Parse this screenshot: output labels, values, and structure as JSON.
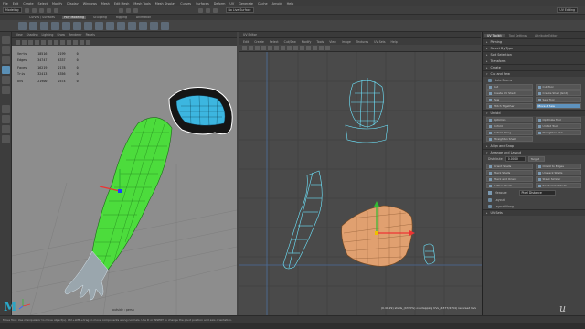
{
  "menu": [
    "File",
    "Edit",
    "Create",
    "Select",
    "Modify",
    "Display",
    "Windows",
    "Mesh",
    "Edit Mesh",
    "Mesh Tools",
    "Mesh Display",
    "Curves",
    "Surfaces",
    "Deform",
    "UV",
    "Generate",
    "Cache",
    "Arnold",
    "Help"
  ],
  "status": {
    "mode": "Modeling",
    "symmetry": "No Live Surface",
    "workspace": "UV Editing"
  },
  "shelf_tabs": [
    {
      "label": "Curves / Surfaces",
      "active": false
    },
    {
      "label": "Poly Modeling",
      "active": true
    },
    {
      "label": "Sculpting",
      "active": false
    },
    {
      "label": "Rigging",
      "active": false
    },
    {
      "label": "Animation",
      "active": false
    }
  ],
  "viewport": {
    "menus": [
      "View",
      "Shading",
      "Lighting",
      "Show",
      "Renderer",
      "Panels"
    ],
    "hud": [
      {
        "label": "Verts",
        "a": "18516",
        "b": "2199",
        "c": "0"
      },
      {
        "label": "Edges",
        "a": "34747",
        "b": "4337",
        "c": "0"
      },
      {
        "label": "Faces",
        "a": "16219",
        "b": "2178",
        "c": "0"
      },
      {
        "label": "Tris",
        "a": "32413",
        "b": "4356",
        "c": "0"
      },
      {
        "label": "UVs",
        "a": "21900",
        "b": "2574",
        "c": "0"
      }
    ],
    "camera": "outside : persp"
  },
  "uv_editor": {
    "title": "UV Editor",
    "menus": [
      "Edit",
      "Create",
      "Select",
      "Cut/Sew",
      "Modify",
      "Tools",
      "View",
      "Image",
      "Textures",
      "UV Sets",
      "Help"
    ],
    "stat": "(0.40.29) shells_(4370%) overlapping UVs_(4377/4354) reversed UVs"
  },
  "toolkit": {
    "tabs": [
      {
        "label": "UV Toolkit",
        "active": true
      },
      {
        "label": "Tool Settings",
        "active": false
      },
      {
        "label": "Attribute Editor",
        "active": false
      }
    ],
    "sections": {
      "pinning": "Pinning",
      "select_by_type": "Select By Type",
      "soft_selection": "Soft Selection",
      "transform": "Transform",
      "create": "Create",
      "cut_and_sew": "Cut and Sew",
      "unfold": "Unfold",
      "align_and_snap": "Align and Snap",
      "arrange_and_layout": "Arrange and Layout",
      "uv_sets": "UV Sets"
    },
    "auto_seams": "Auto Seams",
    "cut_sew": [
      "Cut",
      "Cut Tool",
      "Create UV Shell",
      "Create Shell (Grid)",
      "Sew",
      "Sew Tool",
      "Stitch Together",
      "Move & Sew"
    ],
    "unfold": [
      "Optimize",
      "Optimize Tool",
      "Unfold",
      "Unfold Tool",
      "Unfold Along",
      "Straighten UVs",
      "Straighten Shell"
    ],
    "arrange": [
      "Orient Shells",
      "Orient to Edges",
      "Stack Shells",
      "Unstack Shells",
      "Stack and Orient",
      "Stack Similar",
      "Gather Shells",
      "Randomize Shells"
    ],
    "distribute_label": "Distribute",
    "distribute_value": "0.0000",
    "target_label": "Target",
    "measure_label": "Measure",
    "measure_value": "Pixel Distance",
    "layout_label": "Layout",
    "layout_along": "Layout Along"
  },
  "statusbar_text": "Move Tool: Use manipulator to move object(s). Ctrl+LMB+drag to move components along normals. Use D or INSERT to change the pivot position and axis orientation.",
  "logo": "M",
  "watermark": "u",
  "colors": {
    "wire_green": "#4cdc3c",
    "wire_cyan": "#6ee6ff",
    "uv_orange": "#e0a070",
    "maya_blue": "#2aa6c6",
    "accent": "#5e92bd"
  }
}
